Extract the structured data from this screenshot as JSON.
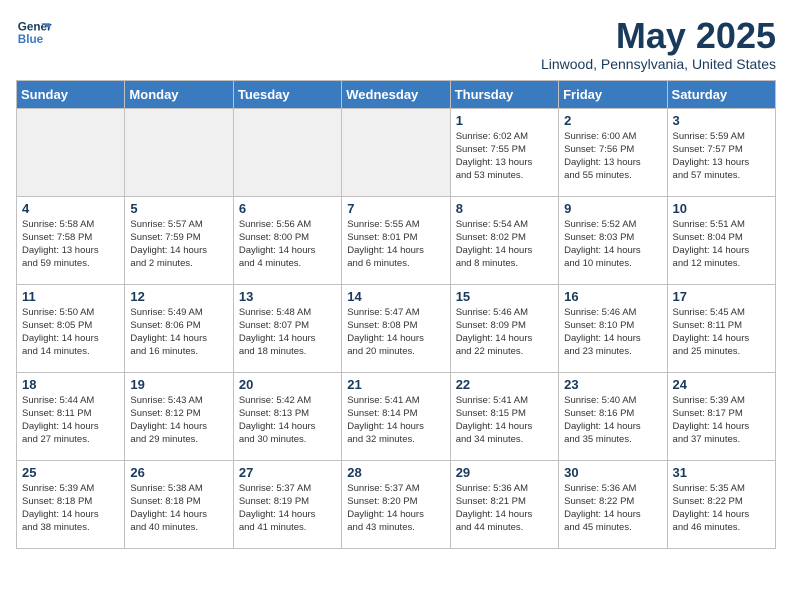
{
  "logo": {
    "line1": "General",
    "line2": "Blue"
  },
  "title": "May 2025",
  "subtitle": "Linwood, Pennsylvania, United States",
  "headers": [
    "Sunday",
    "Monday",
    "Tuesday",
    "Wednesday",
    "Thursday",
    "Friday",
    "Saturday"
  ],
  "weeks": [
    [
      {
        "day": "",
        "info": "",
        "empty": true
      },
      {
        "day": "",
        "info": "",
        "empty": true
      },
      {
        "day": "",
        "info": "",
        "empty": true
      },
      {
        "day": "",
        "info": "",
        "empty": true
      },
      {
        "day": "1",
        "info": "Sunrise: 6:02 AM\nSunset: 7:55 PM\nDaylight: 13 hours\nand 53 minutes.",
        "empty": false
      },
      {
        "day": "2",
        "info": "Sunrise: 6:00 AM\nSunset: 7:56 PM\nDaylight: 13 hours\nand 55 minutes.",
        "empty": false
      },
      {
        "day": "3",
        "info": "Sunrise: 5:59 AM\nSunset: 7:57 PM\nDaylight: 13 hours\nand 57 minutes.",
        "empty": false
      }
    ],
    [
      {
        "day": "4",
        "info": "Sunrise: 5:58 AM\nSunset: 7:58 PM\nDaylight: 13 hours\nand 59 minutes.",
        "empty": false
      },
      {
        "day": "5",
        "info": "Sunrise: 5:57 AM\nSunset: 7:59 PM\nDaylight: 14 hours\nand 2 minutes.",
        "empty": false
      },
      {
        "day": "6",
        "info": "Sunrise: 5:56 AM\nSunset: 8:00 PM\nDaylight: 14 hours\nand 4 minutes.",
        "empty": false
      },
      {
        "day": "7",
        "info": "Sunrise: 5:55 AM\nSunset: 8:01 PM\nDaylight: 14 hours\nand 6 minutes.",
        "empty": false
      },
      {
        "day": "8",
        "info": "Sunrise: 5:54 AM\nSunset: 8:02 PM\nDaylight: 14 hours\nand 8 minutes.",
        "empty": false
      },
      {
        "day": "9",
        "info": "Sunrise: 5:52 AM\nSunset: 8:03 PM\nDaylight: 14 hours\nand 10 minutes.",
        "empty": false
      },
      {
        "day": "10",
        "info": "Sunrise: 5:51 AM\nSunset: 8:04 PM\nDaylight: 14 hours\nand 12 minutes.",
        "empty": false
      }
    ],
    [
      {
        "day": "11",
        "info": "Sunrise: 5:50 AM\nSunset: 8:05 PM\nDaylight: 14 hours\nand 14 minutes.",
        "empty": false
      },
      {
        "day": "12",
        "info": "Sunrise: 5:49 AM\nSunset: 8:06 PM\nDaylight: 14 hours\nand 16 minutes.",
        "empty": false
      },
      {
        "day": "13",
        "info": "Sunrise: 5:48 AM\nSunset: 8:07 PM\nDaylight: 14 hours\nand 18 minutes.",
        "empty": false
      },
      {
        "day": "14",
        "info": "Sunrise: 5:47 AM\nSunset: 8:08 PM\nDaylight: 14 hours\nand 20 minutes.",
        "empty": false
      },
      {
        "day": "15",
        "info": "Sunrise: 5:46 AM\nSunset: 8:09 PM\nDaylight: 14 hours\nand 22 minutes.",
        "empty": false
      },
      {
        "day": "16",
        "info": "Sunrise: 5:46 AM\nSunset: 8:10 PM\nDaylight: 14 hours\nand 23 minutes.",
        "empty": false
      },
      {
        "day": "17",
        "info": "Sunrise: 5:45 AM\nSunset: 8:11 PM\nDaylight: 14 hours\nand 25 minutes.",
        "empty": false
      }
    ],
    [
      {
        "day": "18",
        "info": "Sunrise: 5:44 AM\nSunset: 8:11 PM\nDaylight: 14 hours\nand 27 minutes.",
        "empty": false
      },
      {
        "day": "19",
        "info": "Sunrise: 5:43 AM\nSunset: 8:12 PM\nDaylight: 14 hours\nand 29 minutes.",
        "empty": false
      },
      {
        "day": "20",
        "info": "Sunrise: 5:42 AM\nSunset: 8:13 PM\nDaylight: 14 hours\nand 30 minutes.",
        "empty": false
      },
      {
        "day": "21",
        "info": "Sunrise: 5:41 AM\nSunset: 8:14 PM\nDaylight: 14 hours\nand 32 minutes.",
        "empty": false
      },
      {
        "day": "22",
        "info": "Sunrise: 5:41 AM\nSunset: 8:15 PM\nDaylight: 14 hours\nand 34 minutes.",
        "empty": false
      },
      {
        "day": "23",
        "info": "Sunrise: 5:40 AM\nSunset: 8:16 PM\nDaylight: 14 hours\nand 35 minutes.",
        "empty": false
      },
      {
        "day": "24",
        "info": "Sunrise: 5:39 AM\nSunset: 8:17 PM\nDaylight: 14 hours\nand 37 minutes.",
        "empty": false
      }
    ],
    [
      {
        "day": "25",
        "info": "Sunrise: 5:39 AM\nSunset: 8:18 PM\nDaylight: 14 hours\nand 38 minutes.",
        "empty": false
      },
      {
        "day": "26",
        "info": "Sunrise: 5:38 AM\nSunset: 8:18 PM\nDaylight: 14 hours\nand 40 minutes.",
        "empty": false
      },
      {
        "day": "27",
        "info": "Sunrise: 5:37 AM\nSunset: 8:19 PM\nDaylight: 14 hours\nand 41 minutes.",
        "empty": false
      },
      {
        "day": "28",
        "info": "Sunrise: 5:37 AM\nSunset: 8:20 PM\nDaylight: 14 hours\nand 43 minutes.",
        "empty": false
      },
      {
        "day": "29",
        "info": "Sunrise: 5:36 AM\nSunset: 8:21 PM\nDaylight: 14 hours\nand 44 minutes.",
        "empty": false
      },
      {
        "day": "30",
        "info": "Sunrise: 5:36 AM\nSunset: 8:22 PM\nDaylight: 14 hours\nand 45 minutes.",
        "empty": false
      },
      {
        "day": "31",
        "info": "Sunrise: 5:35 AM\nSunset: 8:22 PM\nDaylight: 14 hours\nand 46 minutes.",
        "empty": false
      }
    ]
  ]
}
